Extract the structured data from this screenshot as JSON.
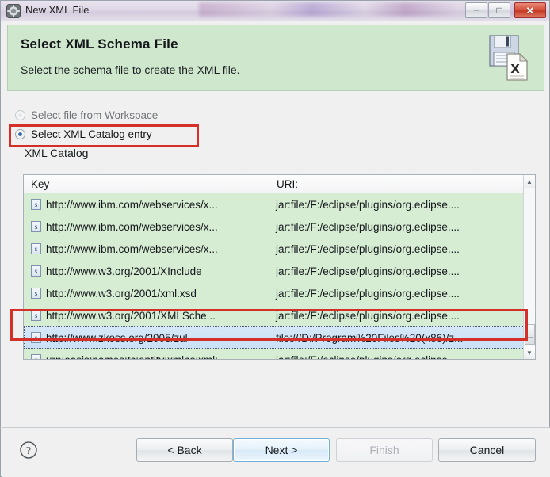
{
  "window": {
    "title": "New XML File",
    "app_icon": "gear-icon",
    "controls": {
      "minimize": "–",
      "maximize": "□",
      "close": "✕"
    }
  },
  "banner": {
    "title": "Select XML Schema File",
    "description": "Select the schema file to create the XML file.",
    "icon": "xml-file-save-icon",
    "background_color": "#cfe8cd"
  },
  "options": {
    "workspace": {
      "label": "Select file from Workspace",
      "selected": false,
      "enabled": false
    },
    "catalog": {
      "label": "Select XML Catalog entry",
      "selected": true,
      "enabled": true
    }
  },
  "catalog": {
    "group_label": "XML Catalog",
    "columns": [
      "Key",
      "URI:"
    ],
    "rows": [
      {
        "icon": "s",
        "key": "http://www.ibm.com/webservices/x...",
        "uri": "jar:file:/F:/eclipse/plugins/org.eclipse....",
        "selected": false
      },
      {
        "icon": "s",
        "key": "http://www.ibm.com/webservices/x...",
        "uri": "jar:file:/F:/eclipse/plugins/org.eclipse....",
        "selected": false
      },
      {
        "icon": "s",
        "key": "http://www.ibm.com/webservices/x...",
        "uri": "jar:file:/F:/eclipse/plugins/org.eclipse....",
        "selected": false
      },
      {
        "icon": "s",
        "key": "http://www.w3.org/2001/XInclude",
        "uri": "jar:file:/F:/eclipse/plugins/org.eclipse....",
        "selected": false
      },
      {
        "icon": "s",
        "key": "http://www.w3.org/2001/xml.xsd",
        "uri": "jar:file:/F:/eclipse/plugins/org.eclipse....",
        "selected": false
      },
      {
        "icon": "s",
        "key": "http://www.w3.org/2001/XMLSche...",
        "uri": "jar:file:/F:/eclipse/plugins/org.eclipse....",
        "selected": false
      },
      {
        "icon": "s",
        "key": "http://www.zkoss.org/2005/zul",
        "uri": "file:///D:/Program%20Files%20(x86)/z...",
        "selected": true
      },
      {
        "icon": "s",
        "key": "urn:oasis:names:tc:entity:xmlns:xml:...",
        "uri": "jar:file:/F:/eclipse/plugins/org.eclipse....",
        "selected": false
      }
    ],
    "scrollbar": {
      "up": "▲",
      "down": "▼"
    }
  },
  "annotations": {
    "color": "#d4302a",
    "boxes": [
      "radio-catalog-highlight",
      "selected-row-highlight"
    ]
  },
  "footer": {
    "help": "?",
    "buttons": {
      "back": {
        "label": "< Back",
        "enabled": true,
        "default": false
      },
      "next": {
        "label": "Next >",
        "enabled": true,
        "default": true
      },
      "finish": {
        "label": "Finish",
        "enabled": false,
        "default": false
      },
      "cancel": {
        "label": "Cancel",
        "enabled": true,
        "default": false
      }
    }
  }
}
